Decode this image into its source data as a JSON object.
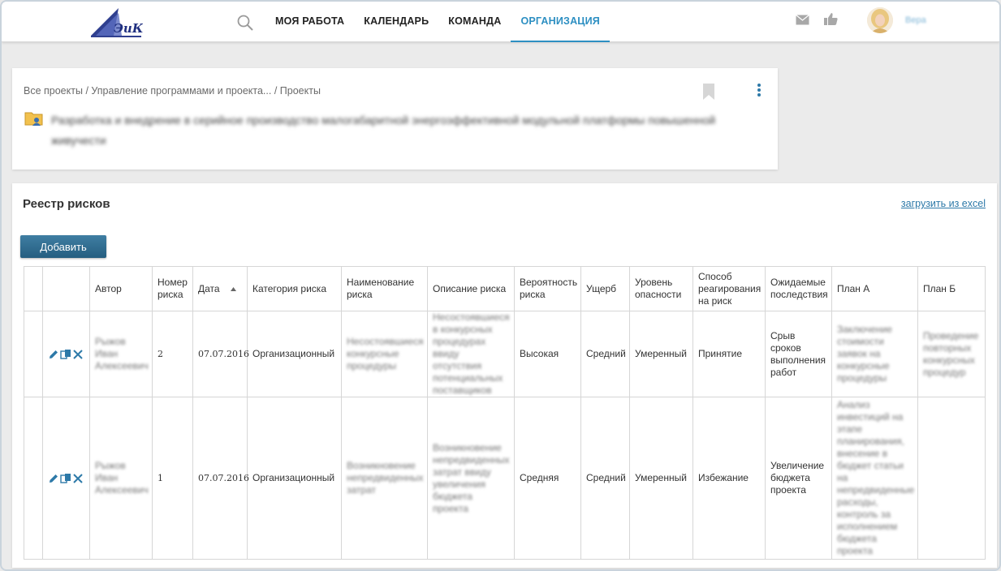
{
  "nav": {
    "items": [
      "МОЯ РАБОТА",
      "КАЛЕНДАРЬ",
      "КОМАНДА",
      "ОРГАНИЗАЦИЯ"
    ],
    "active_index": 3,
    "user_name": "Вера"
  },
  "project": {
    "breadcrumb": [
      "Все проекты",
      "Управление программами и проекта...",
      "Проекты"
    ],
    "title": "Разработка и внедрение в серийное производство малогабаритной энергоэффективной модульной платформы повышенной живучести"
  },
  "registry": {
    "title": "Реестр рисков",
    "excel_link": "загрузить из excel",
    "add_button": "Добавить",
    "columns": [
      "Автор",
      "Номер риска",
      "Дата",
      "Категория риска",
      "Наименование риска",
      "Описание риска",
      "Вероятность риска",
      "Ущерб",
      "Уровень опасности",
      "Способ реагирования на риск",
      "Ожидаемые последствия",
      "План А",
      "План Б"
    ],
    "rows": [
      {
        "author": "Рыжов Иван Алексеевич",
        "number": "2",
        "date": "07.07.2016",
        "category": "Организационный",
        "name": "Несостоявшиеся конкурсные процедуры",
        "description": "Несостоявшиеся в конкурсных процедурах ввиду отсутствия потенциальных поставщиков",
        "probability": "Высокая",
        "damage": "Средний",
        "danger": "Умеренный",
        "response": "Принятие",
        "consequences": "Срыв сроков выполнения работ",
        "plan_a": "Заключение стоимости заявок на конкурсные процедуры",
        "plan_b": "Проведение повторных конкурсных процедур"
      },
      {
        "author": "Рыжов Иван Алексеевич",
        "number": "1",
        "date": "07.07.2016",
        "category": "Организационный",
        "name": "Возникновение непредвиденных затрат",
        "description": "Возникновение непредвиденных затрат ввиду увеличения бюджета проекта",
        "probability": "Средняя",
        "damage": "Средний",
        "danger": "Умеренный",
        "response": "Избежание",
        "consequences": "Увеличение бюджета проекта",
        "plan_a": "Анализ инвестиций на этапе планирования, внесение в бюджет статьи на непредвиденные расходы, контроль за исполнением бюджета проекта",
        "plan_b": ""
      }
    ]
  },
  "colors": {
    "accent": "#2d8fc2",
    "button": "#2f6b8e",
    "link": "#2d79a8"
  }
}
